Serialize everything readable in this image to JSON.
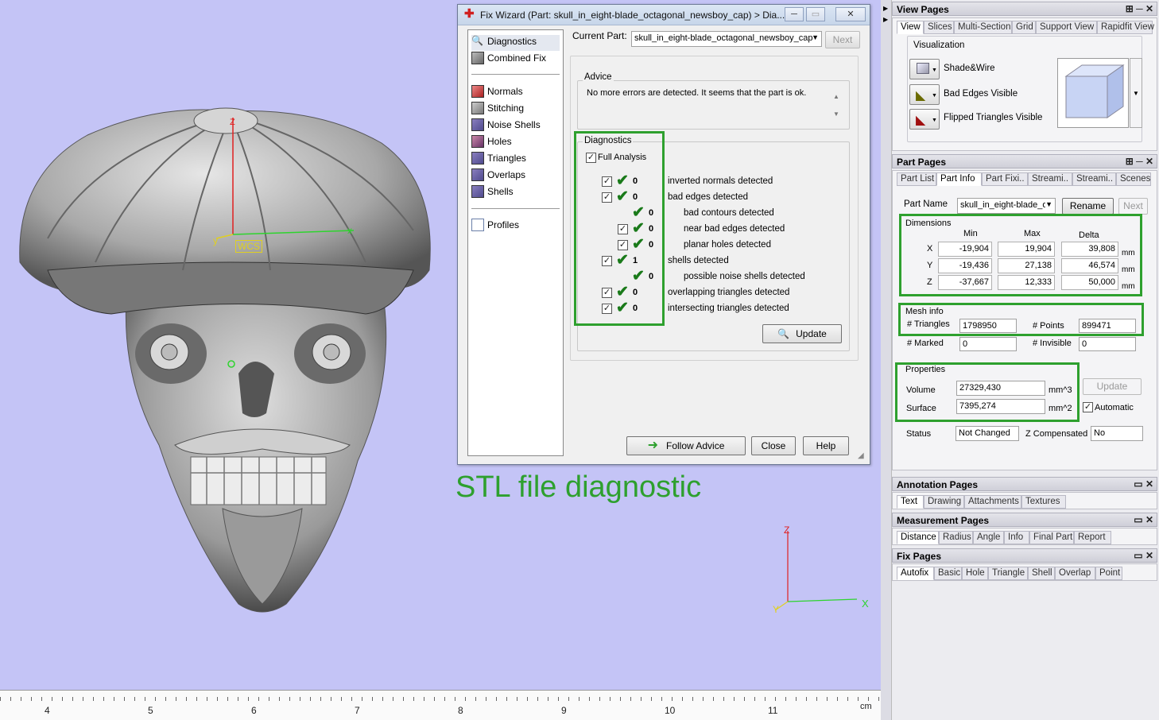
{
  "caption": "STL file diagnostic",
  "viewport": {
    "axis_z": "Z",
    "axis_y": "y",
    "axis_x": "x",
    "wcs": "WCS",
    "corner_z": "Z",
    "corner_y": "Y",
    "corner_x": "X",
    "ruler_labels": [
      "4",
      "5",
      "6",
      "7",
      "8",
      "9",
      "10",
      "11"
    ],
    "ruler_unit": "cm"
  },
  "wizard": {
    "title": "Fix Wizard (Part: skull_in_eight-blade_octagonal_newsboy_cap) > Dia...",
    "win_buttons": [
      "─",
      "▭",
      "✕"
    ],
    "nav": {
      "diagnostics": "Diagnostics",
      "combined_fix": "Combined Fix",
      "normals": "Normals",
      "stitching": "Stitching",
      "noise_shells": "Noise Shells",
      "holes": "Holes",
      "triangles": "Triangles",
      "overlaps": "Overlaps",
      "shells": "Shells",
      "profiles": "Profiles"
    },
    "current_part_label": "Current Part:",
    "current_part_value": "skull_in_eight-blade_octagonal_newsboy_cap",
    "next": "Next",
    "advice_title": "Advice",
    "advice_text": "No more errors are detected. It seems that the part is ok.",
    "diag_title": "Diagnostics",
    "full_analysis": "Full Analysis",
    "rows": [
      {
        "count": "0",
        "label": "inverted normals detected",
        "box": true,
        "indent": 0
      },
      {
        "count": "0",
        "label": "bad edges detected",
        "box": true,
        "indent": 0
      },
      {
        "count": "0",
        "label": "bad contours detected",
        "box": false,
        "indent": 1
      },
      {
        "count": "0",
        "label": "near bad edges detected",
        "box": true,
        "indent": 1
      },
      {
        "count": "0",
        "label": "planar holes detected",
        "box": true,
        "indent": 1
      },
      {
        "count": "1",
        "label": "shells detected",
        "box": true,
        "indent": 0
      },
      {
        "count": "0",
        "label": "possible noise shells detected",
        "box": false,
        "indent": 1
      },
      {
        "count": "0",
        "label": "overlapping triangles detected",
        "box": true,
        "indent": 0
      },
      {
        "count": "0",
        "label": "intersecting triangles detected",
        "box": true,
        "indent": 0
      }
    ],
    "update": "Update",
    "follow_advice": "Follow Advice",
    "close": "Close",
    "help": "Help"
  },
  "view_pages": {
    "title": "View Pages",
    "tabs": [
      "View",
      "Slices",
      "Multi-Section",
      "Grid",
      "Support View",
      "Rapidfit View"
    ],
    "visualization": "Visualization",
    "items": [
      "Shade&Wire",
      "Bad Edges Visible",
      "Flipped Triangles Visible"
    ]
  },
  "part_pages": {
    "title": "Part Pages",
    "tabs": [
      "Part List",
      "Part Info",
      "Part Fixi..",
      "Streami..",
      "Streami..",
      "Scenes"
    ],
    "part_name_label": "Part Name",
    "part_name_value": "skull_in_eight-blade_o",
    "rename": "Rename",
    "next": "Next",
    "dimensions": "Dimensions",
    "col_min": "Min",
    "col_max": "Max",
    "col_delta": "Delta",
    "unit": "mm",
    "rows": [
      {
        "axis": "X",
        "min": "-19,904",
        "max": "19,904",
        "delta": "39,808"
      },
      {
        "axis": "Y",
        "min": "-19,436",
        "max": "27,138",
        "delta": "46,574"
      },
      {
        "axis": "Z",
        "min": "-37,667",
        "max": "12,333",
        "delta": "50,000"
      }
    ],
    "mesh_info": "Mesh info",
    "triangles_label": "# Triangles",
    "triangles": "1798950",
    "points_label": "# Points",
    "points": "899471",
    "marked_label": "# Marked",
    "marked": "0",
    "invisible_label": "# Invisible",
    "invisible": "0",
    "properties": "Properties",
    "volume_label": "Volume",
    "volume": "27329,430",
    "volume_unit": "mm^3",
    "surface_label": "Surface",
    "surface": "7395,274",
    "surface_unit": "mm^2",
    "update": "Update",
    "automatic": "Automatic",
    "status_label": "Status",
    "status": "Not Changed",
    "zcomp_label": "Z Compensated",
    "zcomp": "No"
  },
  "annotation_pages": {
    "title": "Annotation Pages",
    "tabs": [
      "Text",
      "Drawing",
      "Attachments",
      "Textures"
    ]
  },
  "measurement_pages": {
    "title": "Measurement Pages",
    "tabs": [
      "Distance",
      "Radius",
      "Angle",
      "Info",
      "Final Part",
      "Report"
    ]
  },
  "fix_pages": {
    "title": "Fix Pages",
    "tabs": [
      "Autofix",
      "Basic",
      "Hole",
      "Triangle",
      "Shell",
      "Overlap",
      "Point"
    ]
  },
  "colors": {
    "highlight": "#2ea02e",
    "viewport": "#c4c4f6"
  }
}
